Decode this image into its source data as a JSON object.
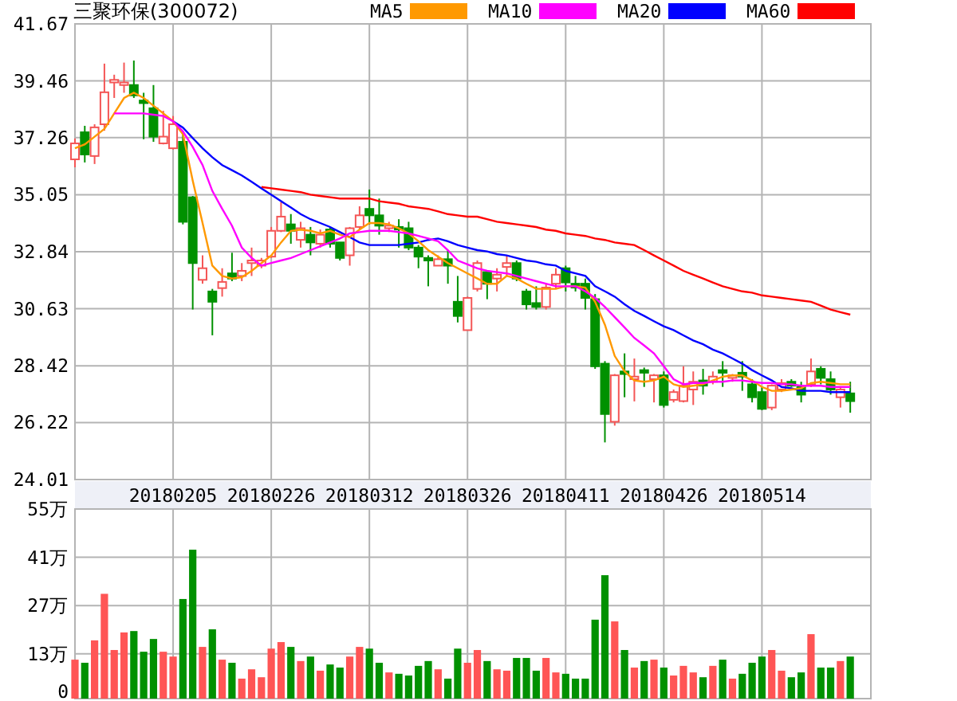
{
  "title": "三聚环保(300072)",
  "price_chart": {
    "chart_data": {
      "type": "candlestick",
      "grid": true,
      "categories": [
        null,
        null,
        null,
        null,
        null,
        null,
        null,
        null,
        null,
        null,
        "20180205",
        null,
        null,
        null,
        null,
        null,
        null,
        null,
        null,
        null,
        "20180226",
        null,
        null,
        null,
        null,
        null,
        null,
        null,
        null,
        null,
        "20180312",
        null,
        null,
        null,
        null,
        null,
        null,
        null,
        null,
        null,
        "20180326",
        null,
        null,
        null,
        null,
        null,
        null,
        null,
        null,
        null,
        "20180411",
        null,
        null,
        null,
        null,
        null,
        null,
        null,
        null,
        null,
        "20180426",
        null,
        null,
        null,
        null,
        null,
        null,
        null,
        null,
        null,
        "20180514",
        null,
        null,
        null,
        null,
        null,
        null,
        null,
        null,
        null
      ],
      "ylim": [
        24.01,
        41.67
      ],
      "yticks": [
        {
          "value": 41.67,
          "label": "41.67"
        },
        {
          "value": 39.46,
          "label": "39.46"
        },
        {
          "value": 37.26,
          "label": "37.26"
        },
        {
          "value": 35.05,
          "label": "35.05"
        },
        {
          "value": 32.84,
          "label": "32.84"
        },
        {
          "value": 30.63,
          "label": "30.63"
        },
        {
          "value": 28.42,
          "label": "28.42"
        },
        {
          "value": 26.22,
          "label": "26.22"
        },
        {
          "value": 24.01,
          "label": "24.01"
        }
      ],
      "series": [
        {
          "name": "MA5",
          "type": "line",
          "color": "#ff9900",
          "values": [
            36.85,
            37.0,
            37.3,
            37.6,
            38.2,
            38.8,
            39.0,
            38.8,
            38.5,
            38.2,
            37.9,
            37.4,
            35.6,
            33.95,
            32.3,
            31.9,
            31.8,
            31.85,
            32.1,
            32.4,
            32.7,
            33.2,
            33.65,
            33.7,
            33.65,
            33.55,
            33.65,
            33.5,
            33.4,
            33.7,
            33.95,
            33.95,
            33.9,
            33.75,
            33.55,
            33.25,
            32.9,
            32.65,
            32.4,
            32.2,
            32.0,
            31.8,
            31.6,
            31.6,
            31.9,
            31.8,
            31.6,
            31.4,
            31.4,
            31.4,
            31.5,
            31.5,
            31.45,
            30.9,
            30.0,
            28.8,
            28.2,
            27.85,
            27.8,
            27.85,
            28.0,
            27.7,
            27.6,
            27.65,
            27.7,
            27.85,
            28.0,
            28.05,
            28.05,
            27.85,
            27.6,
            27.45,
            27.45,
            27.5,
            27.55,
            27.75,
            27.8,
            27.75,
            27.7,
            27.7
          ]
        },
        {
          "name": "MA10",
          "type": "line",
          "color": "#ff00ff",
          "values": [
            null,
            null,
            null,
            null,
            38.2,
            38.2,
            38.2,
            38.2,
            38.15,
            38.1,
            37.9,
            37.5,
            36.9,
            36.2,
            35.2,
            34.5,
            33.85,
            33.0,
            32.6,
            32.3,
            32.4,
            32.5,
            32.6,
            32.75,
            32.9,
            33.05,
            33.2,
            33.35,
            33.55,
            33.6,
            33.65,
            33.65,
            33.65,
            33.6,
            33.55,
            33.45,
            33.35,
            33.25,
            32.9,
            32.5,
            32.35,
            32.2,
            32.1,
            32.05,
            32.0,
            31.9,
            31.8,
            31.7,
            31.6,
            31.5,
            31.5,
            31.5,
            31.3,
            31.05,
            30.7,
            30.3,
            29.9,
            29.5,
            29.2,
            28.9,
            28.4,
            27.9,
            27.7,
            27.75,
            27.75,
            27.8,
            27.8,
            27.85,
            27.85,
            27.8,
            27.75,
            27.75,
            27.7,
            27.7,
            27.65,
            27.65,
            27.65,
            27.6,
            27.6,
            27.6
          ]
        },
        {
          "name": "MA20",
          "type": "line",
          "color": "#0000ff",
          "values": [
            null,
            null,
            null,
            null,
            null,
            null,
            null,
            null,
            null,
            null,
            37.9,
            37.65,
            37.25,
            36.85,
            36.5,
            36.2,
            36.0,
            35.8,
            35.55,
            35.3,
            35.05,
            34.8,
            34.55,
            34.3,
            34.1,
            33.95,
            33.8,
            33.6,
            33.4,
            33.2,
            33.1,
            33.1,
            33.1,
            33.1,
            33.15,
            33.2,
            33.3,
            33.35,
            33.25,
            33.1,
            33.0,
            32.9,
            32.85,
            32.75,
            32.7,
            32.6,
            32.5,
            32.45,
            32.35,
            32.3,
            32.1,
            32.0,
            31.9,
            31.5,
            31.3,
            31.1,
            30.8,
            30.55,
            30.35,
            30.15,
            29.95,
            29.8,
            29.6,
            29.4,
            29.25,
            29.05,
            28.9,
            28.7,
            28.5,
            28.25,
            28.05,
            27.85,
            27.6,
            27.55,
            27.45,
            27.45,
            27.45,
            27.4,
            27.4,
            27.4
          ]
        },
        {
          "name": "MA60",
          "type": "line",
          "color": "#ff0000",
          "values": [
            null,
            null,
            null,
            null,
            null,
            null,
            null,
            null,
            null,
            null,
            null,
            null,
            null,
            null,
            null,
            null,
            null,
            null,
            null,
            35.35,
            35.3,
            35.25,
            35.2,
            35.15,
            35.05,
            35.0,
            34.95,
            34.9,
            34.9,
            34.9,
            34.9,
            34.8,
            34.75,
            34.7,
            34.6,
            34.55,
            34.5,
            34.4,
            34.3,
            34.25,
            34.2,
            34.2,
            34.1,
            34.0,
            33.95,
            33.9,
            33.85,
            33.8,
            33.7,
            33.65,
            33.55,
            33.5,
            33.45,
            33.35,
            33.3,
            33.2,
            33.15,
            33.1,
            32.9,
            32.7,
            32.5,
            32.3,
            32.1,
            31.95,
            31.8,
            31.65,
            31.5,
            31.4,
            31.3,
            31.25,
            31.15,
            31.1,
            31.05,
            31.0,
            30.95,
            30.9,
            30.75,
            30.6,
            30.5,
            30.4
          ]
        }
      ],
      "ohlc": [
        [
          36.42,
          37.23,
          36.11,
          37.04
        ],
        [
          37.47,
          37.72,
          36.3,
          36.61
        ],
        [
          36.55,
          37.78,
          36.24,
          37.66
        ],
        [
          37.78,
          40.13,
          37.53,
          39.02
        ],
        [
          39.4,
          39.7,
          38.8,
          39.5
        ],
        [
          39.3,
          40.17,
          39.0,
          39.4
        ],
        [
          39.3,
          40.25,
          38.8,
          38.9
        ],
        [
          38.7,
          39.0,
          37.2,
          38.6
        ],
        [
          38.4,
          39.3,
          37.1,
          37.3
        ],
        [
          37.04,
          38.3,
          37.0,
          37.3
        ],
        [
          36.85,
          38.1,
          36.8,
          37.78
        ],
        [
          37.1,
          37.5,
          33.9,
          34.0
        ],
        [
          34.95,
          35.0,
          30.6,
          32.4
        ],
        [
          31.75,
          32.7,
          31.6,
          32.2
        ],
        [
          31.3,
          31.4,
          29.6,
          30.9
        ],
        [
          31.43,
          32.2,
          31.1,
          31.67
        ],
        [
          32.0,
          32.8,
          31.7,
          31.8
        ],
        [
          31.9,
          32.4,
          31.7,
          32.1
        ],
        [
          32.4,
          33.0,
          31.9,
          32.5
        ],
        [
          32.3,
          32.6,
          32.2,
          32.5
        ],
        [
          32.65,
          33.8,
          32.6,
          33.65
        ],
        [
          33.65,
          34.76,
          33.6,
          34.2
        ],
        [
          33.9,
          34.3,
          33.15,
          33.65
        ],
        [
          33.3,
          34.0,
          33.0,
          33.75
        ],
        [
          33.5,
          33.8,
          32.7,
          33.2
        ],
        [
          33.15,
          33.7,
          33.0,
          33.5
        ],
        [
          33.7,
          33.8,
          33.0,
          33.15
        ],
        [
          33.2,
          33.2,
          32.5,
          32.6
        ],
        [
          32.7,
          33.8,
          32.3,
          33.75
        ],
        [
          33.8,
          34.6,
          33.7,
          34.25
        ],
        [
          34.5,
          35.25,
          33.9,
          34.25
        ],
        [
          34.25,
          34.9,
          33.5,
          33.85
        ],
        [
          33.75,
          34.0,
          33.6,
          33.85
        ],
        [
          33.8,
          34.1,
          33.0,
          33.7
        ],
        [
          33.75,
          34.0,
          32.9,
          33.0
        ],
        [
          33.0,
          33.1,
          32.2,
          32.65
        ],
        [
          32.6,
          32.7,
          31.5,
          32.5
        ],
        [
          32.3,
          32.7,
          32.3,
          32.55
        ],
        [
          32.55,
          32.9,
          31.6,
          32.3
        ],
        [
          30.9,
          31.9,
          30.1,
          30.35
        ],
        [
          29.8,
          31.1,
          29.8,
          31.05
        ],
        [
          31.4,
          32.5,
          31.3,
          32.4
        ],
        [
          32.05,
          32.1,
          31.0,
          31.6
        ],
        [
          31.8,
          32.2,
          31.3,
          31.95
        ],
        [
          32.25,
          32.7,
          31.9,
          32.4
        ],
        [
          32.4,
          32.5,
          31.7,
          31.8
        ],
        [
          31.3,
          31.4,
          30.6,
          30.8
        ],
        [
          30.85,
          31.5,
          30.6,
          30.7
        ],
        [
          30.7,
          31.6,
          30.6,
          31.45
        ],
        [
          31.6,
          32.2,
          31.4,
          31.95
        ],
        [
          32.2,
          32.3,
          31.3,
          31.65
        ],
        [
          31.6,
          31.9,
          31.3,
          31.45
        ],
        [
          31.6,
          31.8,
          30.6,
          31.05
        ],
        [
          31.0,
          31.2,
          28.3,
          28.4
        ],
        [
          28.5,
          28.6,
          25.45,
          26.55
        ],
        [
          26.25,
          28.1,
          26.1,
          28.05
        ],
        [
          28.2,
          28.9,
          27.2,
          28.1
        ],
        [
          27.9,
          28.7,
          27.04,
          28.0
        ],
        [
          28.25,
          28.35,
          27.6,
          28.15
        ],
        [
          27.9,
          28.1,
          27.0,
          28.05
        ],
        [
          28.05,
          28.2,
          26.8,
          26.9
        ],
        [
          27.1,
          27.5,
          27.0,
          27.4
        ],
        [
          27.05,
          28.4,
          27.0,
          27.65
        ],
        [
          27.5,
          28.2,
          26.9,
          27.8
        ],
        [
          27.85,
          28.3,
          27.3,
          27.65
        ],
        [
          27.8,
          28.2,
          27.7,
          28.0
        ],
        [
          28.25,
          28.6,
          27.6,
          28.15
        ],
        [
          27.95,
          28.1,
          27.8,
          28.05
        ],
        [
          28.15,
          28.6,
          27.45,
          28.0
        ],
        [
          27.7,
          27.9,
          27.0,
          27.2
        ],
        [
          27.4,
          27.6,
          26.7,
          26.75
        ],
        [
          26.8,
          27.7,
          26.7,
          27.65
        ],
        [
          27.5,
          27.9,
          27.4,
          27.75
        ],
        [
          27.8,
          27.9,
          27.6,
          27.65
        ],
        [
          27.6,
          27.8,
          27.0,
          27.3
        ],
        [
          27.7,
          28.7,
          27.6,
          28.2
        ],
        [
          28.3,
          28.4,
          27.7,
          27.95
        ],
        [
          27.9,
          28.2,
          27.3,
          27.5
        ],
        [
          27.2,
          27.6,
          26.8,
          27.5
        ],
        [
          27.35,
          27.8,
          26.6,
          27.05
        ]
      ]
    }
  },
  "volume_chart": {
    "chart_data": {
      "type": "bar",
      "grid": true,
      "ylim": [
        0,
        55
      ],
      "yticks": [
        {
          "value": 55,
          "label": "55万"
        },
        {
          "value": 41,
          "label": "41万"
        },
        {
          "value": 27,
          "label": "27万"
        },
        {
          "value": 13,
          "label": "13万"
        },
        {
          "value": 0,
          "label": "0"
        }
      ],
      "values": [
        11.3,
        10.4,
        16.9,
        30.4,
        14.1,
        19.2,
        19.6,
        13.6,
        17.3,
        13.6,
        12.2,
        28.9,
        43.2,
        15.0,
        20.1,
        11.3,
        10.4,
        5.8,
        8.5,
        6.2,
        14.5,
        16.4,
        15.0,
        10.9,
        12.2,
        8.1,
        9.9,
        9.0,
        12.2,
        15.0,
        14.5,
        10.4,
        7.6,
        7.2,
        6.7,
        9.5,
        10.9,
        8.5,
        5.8,
        14.5,
        10.4,
        14.1,
        10.9,
        8.5,
        8.1,
        11.8,
        11.8,
        8.1,
        11.8,
        7.6,
        7.2,
        5.8,
        5.8,
        22.9,
        35.8,
        22.4,
        14.1,
        9.0,
        10.9,
        11.3,
        9.0,
        6.7,
        9.5,
        7.6,
        6.2,
        9.5,
        11.3,
        5.8,
        7.2,
        10.4,
        12.2,
        14.1,
        8.1,
        6.2,
        7.6,
        18.7,
        9.0,
        9.0,
        10.9,
        12.2
      ]
    }
  }
}
